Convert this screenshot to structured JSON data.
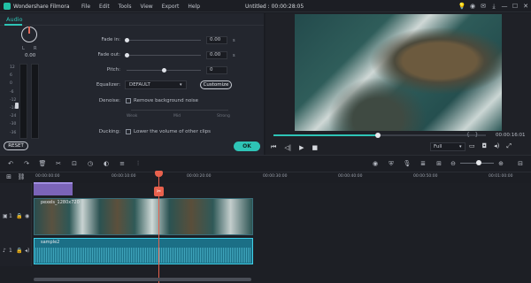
{
  "app": {
    "name": "Wondershare Filmora",
    "doc_title": "Untitled : 00:00:28:05"
  },
  "menu": [
    "File",
    "Edit",
    "Tools",
    "View",
    "Export",
    "Help"
  ],
  "panel": {
    "tab": "Audio",
    "pan": {
      "left": "L",
      "right": "R",
      "value": "0.00"
    },
    "meter_ticks": [
      "12",
      "6",
      "0",
      "-6",
      "-12",
      "-18",
      "-24",
      "-30",
      "-36"
    ],
    "params": {
      "fade_in": {
        "label": "Fade in:",
        "value": "0.00",
        "unit": "s"
      },
      "fade_out": {
        "label": "Fade out:",
        "value": "0.00",
        "unit": "s"
      },
      "pitch": {
        "label": "Pitch:",
        "value": "0"
      }
    },
    "equalizer": {
      "label": "Equalizer:",
      "selected": "DEFAULT",
      "customize": "Customize"
    },
    "denoise": {
      "label": "Denoise:",
      "checkbox": "Remove background noise",
      "scale": [
        "Weak",
        "Mid",
        "Strong"
      ]
    },
    "ducking": {
      "label": "Ducking:",
      "checkbox": "Lower the volume of other clips"
    },
    "reset": "RESET",
    "ok": "OK"
  },
  "preview": {
    "time": "00:00:16:01",
    "quality": "Full",
    "progress": 0.49
  },
  "ruler": [
    "00:00:00:00",
    "00:00:10:00",
    "00:00:20:00",
    "00:00:30:00",
    "00:00:40:00",
    "00:00:50:00",
    "00:01:00:00"
  ],
  "timeline": {
    "video_clip": "pexels_1280x720",
    "audio_clip": "sample2",
    "track_labels": {
      "video": "1",
      "audio": "1"
    }
  },
  "colors": {
    "accent": "#2ec4b6",
    "playhead": "#e8614d",
    "audio_clip": "#1b6f86",
    "title_clip": "#7b64b8"
  },
  "icons": {
    "window": [
      "lightbulb-icon",
      "account-icon",
      "mail-icon",
      "download-icon",
      "minimize-icon",
      "maximize-icon",
      "close-icon"
    ],
    "toolbar": [
      "undo-icon",
      "redo-icon",
      "delete-icon",
      "cut-icon",
      "crop-icon",
      "speed-icon",
      "color-icon",
      "audio-mixer-icon",
      "split-icon",
      "render-icon",
      "shield-icon",
      "marker-icon",
      "microphone-icon",
      "voiceover-icon",
      "ratio-icon",
      "zoom-out-icon",
      "zoom-in-icon"
    ]
  }
}
